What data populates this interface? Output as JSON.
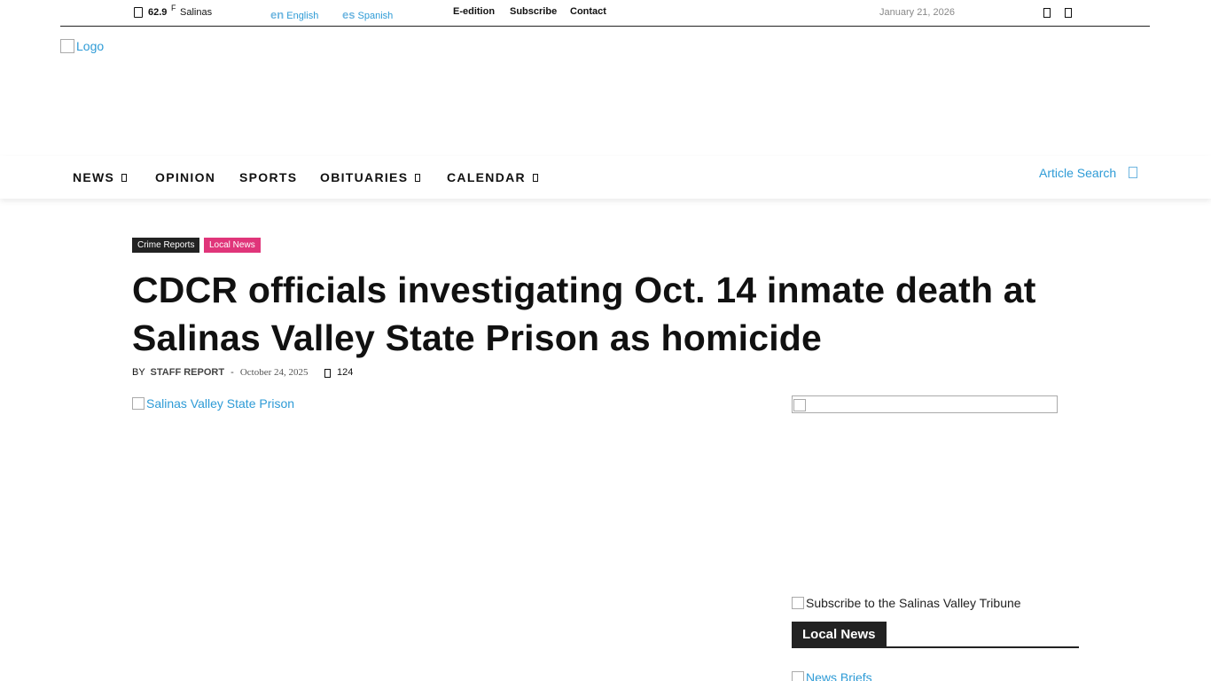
{
  "topbar": {
    "temperature": "62.9",
    "unit": "F",
    "city": "Salinas",
    "lang_en_code": "en",
    "lang_en_label": "English",
    "lang_es_code": "es",
    "lang_es_label": "Spanish",
    "links": [
      "E-edition",
      "Subscribe",
      "Contact"
    ],
    "date": "January 21, 2026"
  },
  "logo_alt": "Logo",
  "nav": {
    "items": [
      "NEWS",
      "OPINION",
      "SPORTS",
      "OBITUARIES",
      "CALENDAR"
    ],
    "search_label": "Article Search"
  },
  "article": {
    "categories": [
      "Crime Reports",
      "Local News"
    ],
    "title": "CDCR officials investigating Oct. 14 inmate death at Salinas Valley State Prison as homicide",
    "by": "BY",
    "author": "STAFF REPORT",
    "date": "October 24, 2025",
    "views": "124",
    "image_alt": "Salinas Valley State Prison"
  },
  "sidebar": {
    "subscribe_alt": "Subscribe to the Salinas Valley Tribune",
    "section_title": "Local News",
    "first_item_alt": "News Briefs"
  },
  "colors": {
    "accent": "#2e9bd6",
    "local_news_tag": "#e0357a",
    "dark": "#222222"
  }
}
